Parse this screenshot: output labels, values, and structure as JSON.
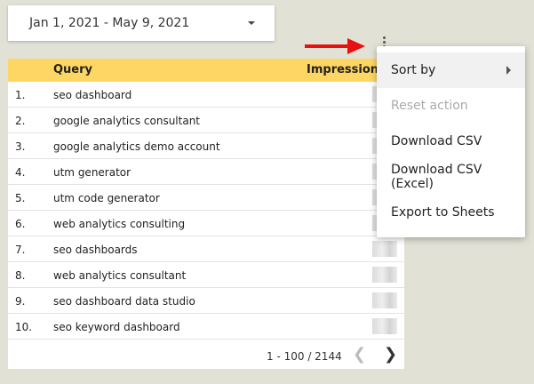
{
  "date_range": {
    "label": "Jan 1, 2021 - May 9, 2021"
  },
  "table": {
    "columns": [
      "Query",
      "Impressions"
    ],
    "rows": [
      {
        "index": "1.",
        "query": "seo dashboard"
      },
      {
        "index": "2.",
        "query": "google analytics consultant"
      },
      {
        "index": "3.",
        "query": "google analytics demo account"
      },
      {
        "index": "4.",
        "query": "utm generator"
      },
      {
        "index": "5.",
        "query": "utm code generator"
      },
      {
        "index": "6.",
        "query": "web analytics consulting"
      },
      {
        "index": "7.",
        "query": "seo dashboards"
      },
      {
        "index": "8.",
        "query": "web analytics consultant"
      },
      {
        "index": "9.",
        "query": "seo dashboard data studio"
      },
      {
        "index": "10.",
        "query": "seo keyword dashboard"
      }
    ],
    "pagination": {
      "range": "1 - 100 / 2144",
      "prev_icon": "chevron-left-icon",
      "next_icon": "chevron-right-icon"
    }
  },
  "menu": {
    "items": [
      {
        "label": "Sort by",
        "has_submenu": true,
        "disabled": false
      },
      {
        "label": "Reset action",
        "has_submenu": false,
        "disabled": true
      },
      {
        "label": "Download CSV",
        "has_submenu": false,
        "disabled": false
      },
      {
        "label": "Download CSV (Excel)",
        "has_submenu": false,
        "disabled": false
      },
      {
        "label": "Export to Sheets",
        "has_submenu": false,
        "disabled": false
      }
    ]
  },
  "colors": {
    "header_bg": "#fdd663",
    "page_bg": "#e1e1d6",
    "arrow": "#e8110f"
  },
  "icons": {
    "menu_trigger": "kebab-menu-icon",
    "annotation": "red-arrow-icon"
  }
}
